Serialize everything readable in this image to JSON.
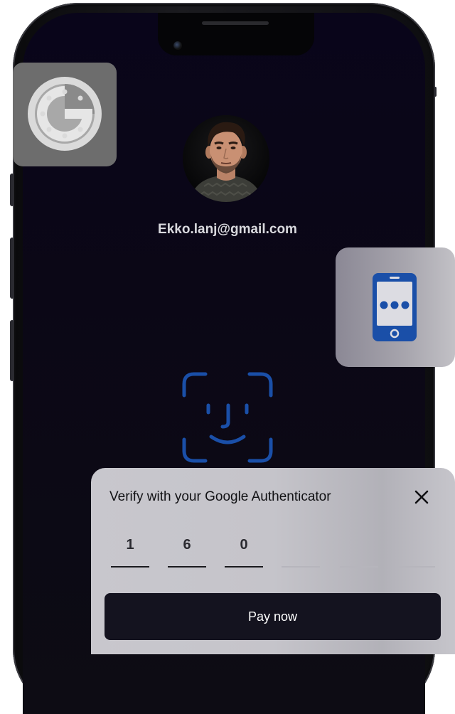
{
  "account": {
    "email": "Ekko.lanj@gmail.com"
  },
  "icons": {
    "google": "google-authenticator-icon",
    "phone": "smartphone-icon",
    "faceid": "face-id-icon",
    "close": "close-icon"
  },
  "verify": {
    "title": "Verify with your Google Authenticator",
    "otp_digits": [
      "1",
      "6",
      "0",
      "",
      "",
      ""
    ],
    "pay_label": "Pay now"
  },
  "colors": {
    "accent_blue": "#1a4fa8",
    "screen_bg": "#09051a",
    "button_bg": "#14131f"
  }
}
